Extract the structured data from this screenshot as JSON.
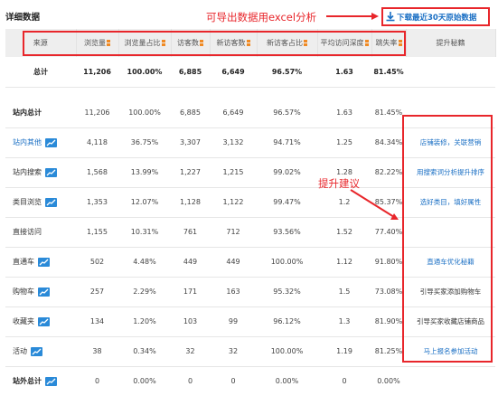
{
  "title": "详细数据",
  "annotation_top": "可导出数据用excel分析",
  "annotation_mid": "提升建议",
  "download_label": "下载最近30天原始数据",
  "colors": {
    "accent_red": "#e8262b",
    "link_blue": "#1a6fc4",
    "icon_blue": "#2a8ad8",
    "sort_orange": "#f08a24"
  },
  "headers": [
    "来源",
    "浏览量",
    "浏览量占比",
    "访客数",
    "新访客数",
    "新访客占比",
    "平均访问深度",
    "跳失率",
    "提升秘籍"
  ],
  "rows": [
    {
      "source": "总计",
      "pv": "11,206",
      "pv_pct": "100.00%",
      "uv": "6,885",
      "new_uv": "6,649",
      "new_pct": "96.57%",
      "depth": "1.63",
      "bounce": "81.45%",
      "tip": ""
    },
    {
      "source": "站内总计",
      "pv": "11,206",
      "pv_pct": "100.00%",
      "uv": "6,885",
      "new_uv": "6,649",
      "new_pct": "96.57%",
      "depth": "1.63",
      "bounce": "81.45%",
      "tip": ""
    },
    {
      "source": "站内其他",
      "pv": "4,118",
      "pv_pct": "36.75%",
      "uv": "3,307",
      "new_uv": "3,132",
      "new_pct": "94.71%",
      "depth": "1.25",
      "bounce": "84.34%",
      "tip": "店铺装修，关联营销"
    },
    {
      "source": "站内搜索",
      "pv": "1,568",
      "pv_pct": "13.99%",
      "uv": "1,227",
      "new_uv": "1,215",
      "new_pct": "99.02%",
      "depth": "1.28",
      "bounce": "82.22%",
      "tip": "用搜索词分析提升排序"
    },
    {
      "source": "类目浏览",
      "pv": "1,353",
      "pv_pct": "12.07%",
      "uv": "1,128",
      "new_uv": "1,122",
      "new_pct": "99.47%",
      "depth": "1.2",
      "bounce": "85.37%",
      "tip": "选好类目，填好属性"
    },
    {
      "source": "直接访问",
      "pv": "1,155",
      "pv_pct": "10.31%",
      "uv": "761",
      "new_uv": "712",
      "new_pct": "93.56%",
      "depth": "1.52",
      "bounce": "77.40%",
      "tip": ""
    },
    {
      "source": "直通车",
      "pv": "502",
      "pv_pct": "4.48%",
      "uv": "449",
      "new_uv": "449",
      "new_pct": "100.00%",
      "depth": "1.12",
      "bounce": "91.80%",
      "tip": "直通车优化秘籍"
    },
    {
      "source": "购物车",
      "pv": "257",
      "pv_pct": "2.29%",
      "uv": "171",
      "new_uv": "163",
      "new_pct": "95.32%",
      "depth": "1.5",
      "bounce": "73.08%",
      "tip": "引导买家添加购物车"
    },
    {
      "source": "收藏夹",
      "pv": "134",
      "pv_pct": "1.20%",
      "uv": "103",
      "new_uv": "99",
      "new_pct": "96.12%",
      "depth": "1.3",
      "bounce": "81.90%",
      "tip": "引导买家收藏店铺商品"
    },
    {
      "source": "活动",
      "pv": "38",
      "pv_pct": "0.34%",
      "uv": "32",
      "new_uv": "32",
      "new_pct": "100.00%",
      "depth": "1.19",
      "bounce": "81.25%",
      "tip": "马上报名参加活动"
    },
    {
      "source": "站外总计",
      "pv": "0",
      "pv_pct": "0.00%",
      "uv": "0",
      "new_uv": "0",
      "new_pct": "0.00%",
      "depth": "0",
      "bounce": "0.00%",
      "tip": ""
    }
  ]
}
